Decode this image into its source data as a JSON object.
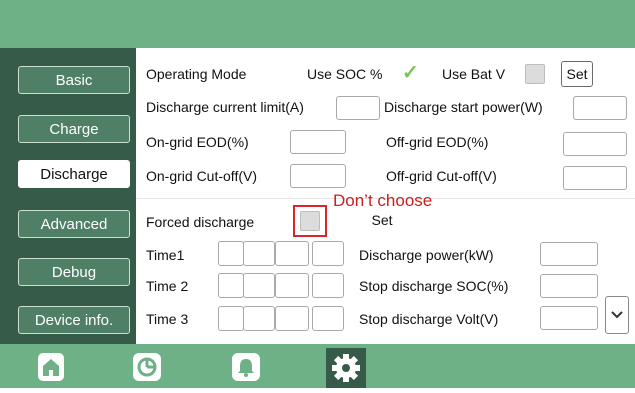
{
  "sidebar": {
    "items": [
      {
        "label": "Basic"
      },
      {
        "label": "Charge"
      },
      {
        "label": "Discharge"
      },
      {
        "label": "Advanced"
      },
      {
        "label": "Debug"
      },
      {
        "label": "Device info."
      }
    ],
    "active": "Discharge"
  },
  "discharge": {
    "operating_mode_label": "Operating Mode",
    "use_soc_label": "Use SOC %",
    "use_soc_checked": true,
    "use_bat_v_label": "Use Bat V",
    "use_bat_v_checked": false,
    "set_label": "Set",
    "discharge_current_limit_label": "Discharge current limit(A)",
    "discharge_start_power_label": "Discharge start power(W)",
    "ongrid_eod_label": "On-grid EOD(%)",
    "offgrid_eod_label": "Off-grid EOD(%)",
    "ongrid_cutoff_label": "On-grid Cut-off(V)",
    "offgrid_cutoff_label": "Off-grid Cut-off(V)",
    "forced_discharge_label": "Forced discharge",
    "forced_discharge_checked": false,
    "annotation": "Don’t choose",
    "time1_label": "Time1",
    "time2_label": "Time 2",
    "time3_label": "Time 3",
    "discharge_power_label": "Discharge power(kW)",
    "stop_discharge_soc_label": "Stop discharge SOC(%)",
    "stop_discharge_volt_label": "Stop discharge Volt(V)"
  },
  "bottom_tabs": [
    {
      "icon": "home-icon"
    },
    {
      "icon": "pie-chart-icon"
    },
    {
      "icon": "bell-icon"
    },
    {
      "icon": "gear-icon"
    }
  ],
  "colors": {
    "top_bar": "#6fb186",
    "sidebar": "#365b48",
    "annotation": "#d8262a",
    "check": "#7cc35a"
  }
}
